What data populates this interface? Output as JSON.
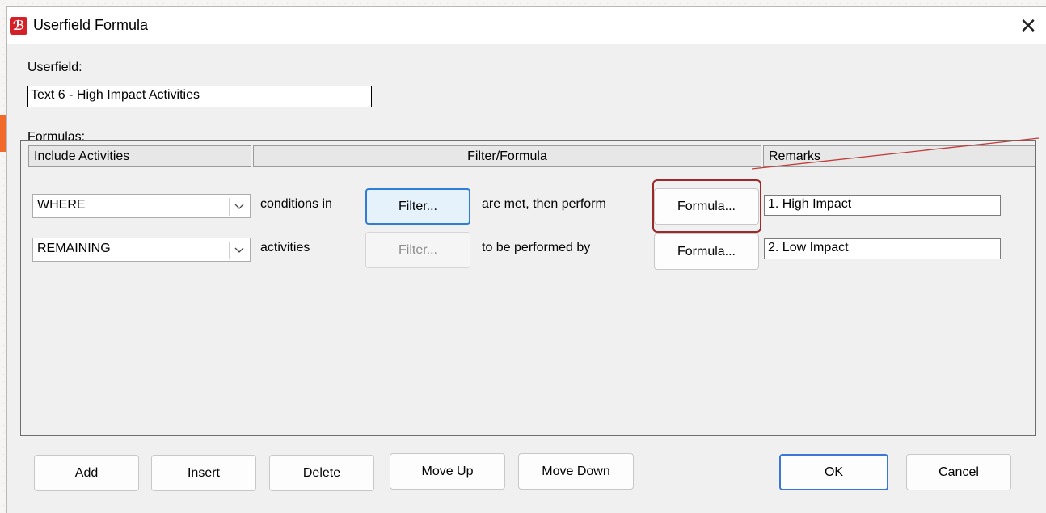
{
  "window": {
    "title": "Userfield Formula",
    "icon": "app-logo-icon",
    "close_glyph": "✕"
  },
  "userfield": {
    "label": "Userfield:",
    "value": "Text 6 - High Impact Activities"
  },
  "formulas": {
    "label": "Formulas:",
    "columns": [
      "Include Activities",
      "Filter/Formula",
      "Remarks"
    ],
    "rows": [
      {
        "include": "WHERE",
        "text1": "conditions in",
        "filter_label": "Filter...",
        "text2": "are met, then perform",
        "formula_label": "Formula...",
        "remark": "1. High Impact"
      },
      {
        "include": "REMAINING",
        "text1": "activities",
        "filter_label": "Filter...",
        "text2": "to be performed by",
        "formula_label": "Formula...",
        "remark": "2. Low Impact"
      }
    ]
  },
  "buttons": {
    "add": "Add",
    "insert": "Insert",
    "delete": "Delete",
    "move_up": "Move Up",
    "move_down": "Move Down",
    "ok": "OK",
    "cancel": "Cancel"
  },
  "colors": {
    "accent_red": "#d42128",
    "highlight": "#9b2a2a",
    "focus_blue": "#2f7dd6"
  }
}
